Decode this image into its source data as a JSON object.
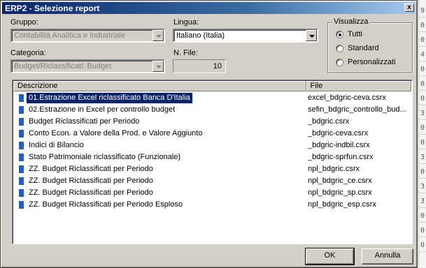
{
  "window": {
    "title": "ERP2 - Selezione report",
    "close_glyph": "x"
  },
  "gruppo": {
    "label": "Gruppo:",
    "value": "Contabilità Analitica e Industriale"
  },
  "lingua": {
    "label": "Lingua:",
    "value": "Italiano (Italia)"
  },
  "categoria": {
    "label": "Categoria:",
    "value": "Budget/Riclassificati: Budget"
  },
  "nfile": {
    "label": "N. File:",
    "value": "10"
  },
  "visualizza": {
    "title": "Visualizza",
    "options": [
      {
        "label": "Tutti",
        "selected": true
      },
      {
        "label": "Standard",
        "selected": false
      },
      {
        "label": "Personalizzati",
        "selected": false
      }
    ]
  },
  "list": {
    "headers": {
      "descrizione": "Descrizione",
      "file": "File"
    },
    "rows": [
      {
        "desc": "01.Estrazione Excel riclassificato Banca D'Italia",
        "file": "excel_bdgric-ceva.csrx",
        "selected": true
      },
      {
        "desc": "02.Estrazione in Excel per controllo budget",
        "file": "sefin_bdgric_controllo_bud..."
      },
      {
        "desc": "Budget Riclassificati per Periodo",
        "file": "_bdgric.csrx"
      },
      {
        "desc": "Conto Econ. a Valore della Prod. e Valore Aggiunto",
        "file": "_bdgric-ceva.csrx"
      },
      {
        "desc": "Indici di Bilancio",
        "file": "_bdgric-indbil.csrx"
      },
      {
        "desc": "Stato Patrimoniale riclassificato (Funzionale)",
        "file": "_bdgric-sprfun.csrx"
      },
      {
        "desc": "ZZ. Budget Riclassificati per Periodo",
        "file": "npl_bdgric.csrx"
      },
      {
        "desc": "ZZ. Budget Riclassificati per Periodo",
        "file": "npl_bdgric_ce.csrx"
      },
      {
        "desc": "ZZ. Budget Riclassificati per Periodo",
        "file": "npl_bdgric_sp.csrx"
      },
      {
        "desc": "ZZ. Budget Riclassificati per Periodo Esploso",
        "file": "npl_bdgric_esp.csrx"
      }
    ]
  },
  "buttons": {
    "ok": "OK",
    "annulla": "Annulla"
  },
  "background": {
    "digits": [
      "9",
      "0",
      "0",
      "4",
      "0",
      "0",
      "0",
      "3",
      "0",
      "0",
      "3",
      "0",
      "3",
      "3",
      "0",
      "0",
      "0"
    ]
  },
  "colors": {
    "title_start": "#0a246a",
    "title_end": "#a6caf0",
    "selection": "#0a246a",
    "item_icon": "#1f5fcc",
    "face": "#d4d0c8"
  }
}
